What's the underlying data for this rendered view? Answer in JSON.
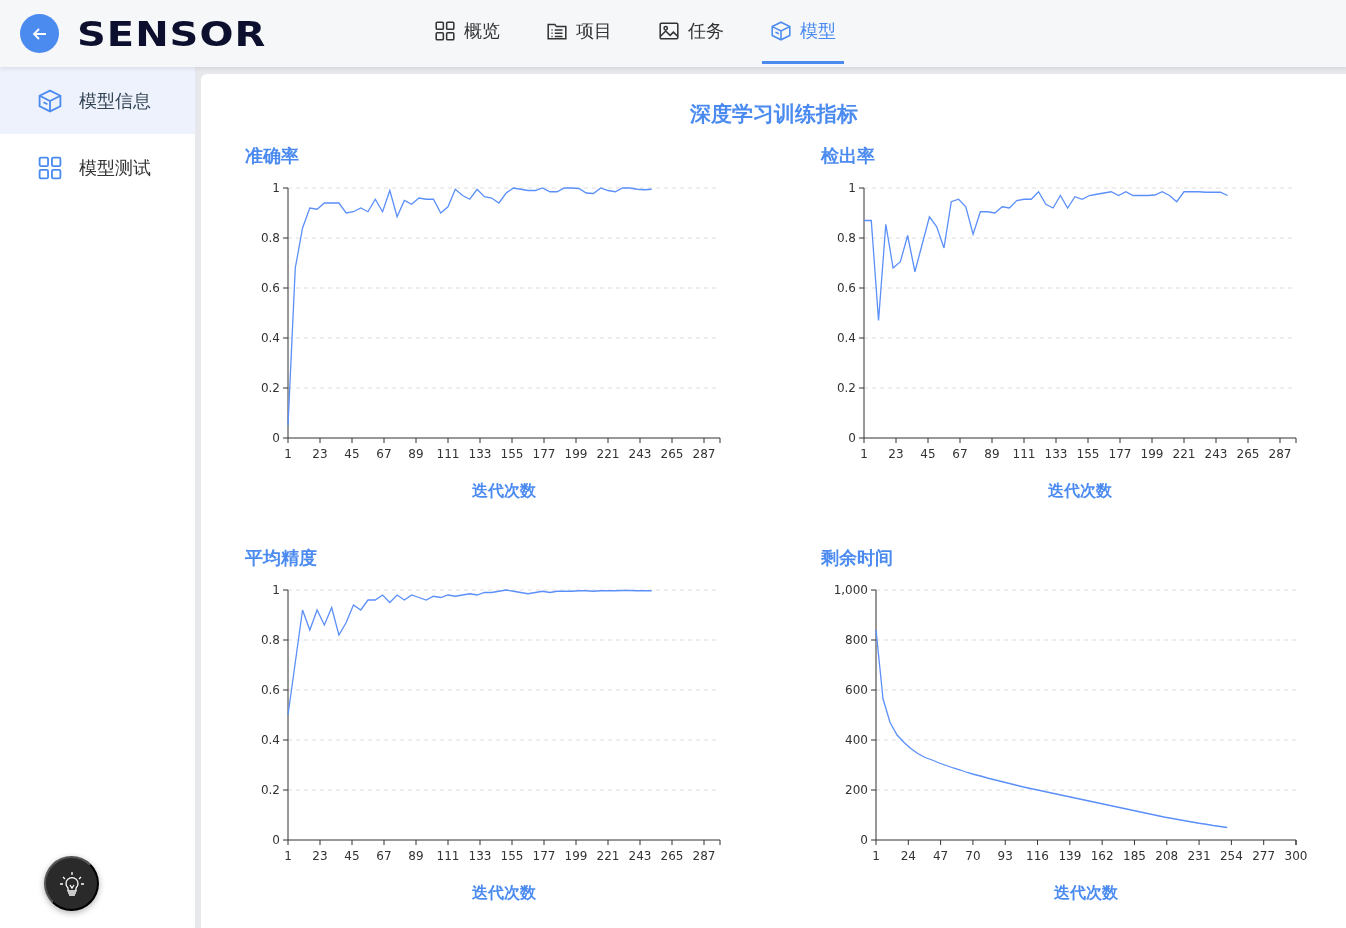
{
  "header": {
    "logo": "SENSOR",
    "nav": [
      {
        "label": "概览",
        "selected": false
      },
      {
        "label": "项目",
        "selected": false
      },
      {
        "label": "任务",
        "selected": false
      },
      {
        "label": "模型",
        "selected": true
      }
    ]
  },
  "sidebar": {
    "items": [
      {
        "label": "模型信息",
        "selected": true
      },
      {
        "label": "模型测试",
        "selected": false
      }
    ]
  },
  "page_title": "深度学习训练指标",
  "charts": [
    {
      "chart_data": {
        "type": "line",
        "grid": true,
        "title": "准确率",
        "xlabel": "迭代次数",
        "xlim": [
          1,
          298
        ],
        "ylim": [
          0,
          1
        ],
        "xticks": [
          1,
          23,
          45,
          67,
          89,
          111,
          133,
          155,
          177,
          199,
          221,
          243,
          265,
          287
        ],
        "yticks": [
          0,
          0.2,
          0.4,
          0.6,
          0.8,
          1
        ],
        "x": [
          1,
          6,
          11,
          16,
          21,
          26,
          31,
          36,
          41,
          46,
          51,
          56,
          61,
          66,
          71,
          76,
          81,
          86,
          91,
          96,
          101,
          106,
          111,
          116,
          121,
          126,
          131,
          136,
          141,
          146,
          151,
          156,
          161,
          166,
          171,
          176,
          181,
          186,
          191,
          196,
          201,
          206,
          211,
          216,
          221,
          226,
          231,
          236,
          241,
          246,
          251
        ],
        "series": [
          {
            "color": "#5b8ff9",
            "values": [
              0.05,
              0.68,
              0.84,
              0.92,
              0.915,
              0.94,
              0.94,
              0.94,
              0.9,
              0.905,
              0.92,
              0.905,
              0.955,
              0.905,
              0.99,
              0.885,
              0.95,
              0.935,
              0.96,
              0.955,
              0.955,
              0.9,
              0.925,
              0.995,
              0.97,
              0.955,
              0.995,
              0.965,
              0.96,
              0.94,
              0.98,
              1,
              0.995,
              0.99,
              0.99,
              1,
              0.985,
              0.985,
              1,
              1,
              0.998,
              0.98,
              0.978,
              1,
              0.99,
              0.985,
              1,
              1,
              0.995,
              0.993,
              0.995
            ]
          }
        ]
      }
    },
    {
      "chart_data": {
        "type": "line",
        "grid": true,
        "title": "检出率",
        "xlabel": "迭代次数",
        "xlim": [
          1,
          298
        ],
        "ylim": [
          0,
          1
        ],
        "xticks": [
          1,
          23,
          45,
          67,
          89,
          111,
          133,
          155,
          177,
          199,
          221,
          243,
          265,
          287
        ],
        "yticks": [
          0,
          0.2,
          0.4,
          0.6,
          0.8,
          1
        ],
        "x": [
          1,
          6,
          11,
          16,
          21,
          26,
          31,
          36,
          41,
          46,
          51,
          56,
          61,
          66,
          71,
          76,
          81,
          86,
          91,
          96,
          101,
          106,
          111,
          116,
          121,
          126,
          131,
          136,
          141,
          146,
          151,
          156,
          161,
          166,
          171,
          176,
          181,
          186,
          191,
          196,
          201,
          206,
          211,
          216,
          221,
          226,
          231,
          236,
          241,
          246,
          251
        ],
        "series": [
          {
            "color": "#5b8ff9",
            "values": [
              0.87,
              0.87,
              0.47,
              0.855,
              0.68,
              0.705,
              0.81,
              0.665,
              0.775,
              0.885,
              0.845,
              0.76,
              0.945,
              0.955,
              0.925,
              0.815,
              0.905,
              0.905,
              0.9,
              0.925,
              0.92,
              0.95,
              0.955,
              0.955,
              0.985,
              0.935,
              0.92,
              0.97,
              0.92,
              0.965,
              0.955,
              0.97,
              0.975,
              0.98,
              0.985,
              0.97,
              0.985,
              0.97,
              0.97,
              0.97,
              0.972,
              0.985,
              0.97,
              0.945,
              0.985,
              0.985,
              0.985,
              0.983,
              0.983,
              0.983,
              0.97
            ]
          }
        ]
      }
    },
    {
      "chart_data": {
        "type": "line",
        "grid": true,
        "title": "平均精度",
        "xlabel": "迭代次数",
        "xlim": [
          1,
          298
        ],
        "ylim": [
          0,
          1
        ],
        "xticks": [
          1,
          23,
          45,
          67,
          89,
          111,
          133,
          155,
          177,
          199,
          221,
          243,
          265,
          287
        ],
        "yticks": [
          0,
          0.2,
          0.4,
          0.6,
          0.8,
          1
        ],
        "x": [
          1,
          6,
          11,
          16,
          21,
          26,
          31,
          36,
          41,
          46,
          51,
          56,
          61,
          66,
          71,
          76,
          81,
          86,
          91,
          96,
          101,
          106,
          111,
          116,
          121,
          126,
          131,
          136,
          141,
          146,
          151,
          156,
          161,
          166,
          171,
          176,
          181,
          186,
          191,
          196,
          201,
          206,
          211,
          216,
          221,
          226,
          231,
          236,
          241,
          246,
          251
        ],
        "series": [
          {
            "color": "#5b8ff9",
            "values": [
              0.5,
              0.71,
              0.92,
              0.84,
              0.92,
              0.86,
              0.93,
              0.82,
              0.87,
              0.94,
              0.92,
              0.96,
              0.96,
              0.98,
              0.95,
              0.98,
              0.96,
              0.98,
              0.97,
              0.96,
              0.975,
              0.97,
              0.98,
              0.975,
              0.98,
              0.985,
              0.98,
              0.99,
              0.99,
              0.995,
              1,
              0.995,
              0.99,
              0.985,
              0.99,
              0.995,
              0.99,
              0.995,
              0.995,
              0.995,
              0.997,
              0.997,
              0.995,
              0.997,
              0.997,
              0.997,
              0.998,
              0.998,
              0.997,
              0.997,
              0.997
            ]
          }
        ]
      }
    },
    {
      "chart_data": {
        "type": "line",
        "grid": true,
        "title": "剩余时间",
        "xlabel": "迭代次数",
        "xlim": [
          1,
          300
        ],
        "ylim": [
          0,
          1000
        ],
        "xticks": [
          1,
          24,
          47,
          70,
          93,
          116,
          139,
          162,
          185,
          208,
          231,
          254,
          277,
          300
        ],
        "yticks": [
          0,
          200,
          400,
          600,
          800,
          {
            "value": 1000,
            "label": "1,000"
          }
        ],
        "x": [
          1,
          6,
          11,
          16,
          21,
          26,
          31,
          36,
          41,
          46,
          51,
          56,
          61,
          66,
          71,
          76,
          81,
          86,
          91,
          96,
          101,
          106,
          111,
          116,
          121,
          126,
          131,
          136,
          141,
          146,
          151,
          156,
          161,
          166,
          171,
          176,
          181,
          186,
          191,
          196,
          201,
          206,
          211,
          216,
          221,
          226,
          231,
          236,
          241,
          246,
          251
        ],
        "series": [
          {
            "color": "#5b8ff9",
            "values": [
              840,
              565,
              470,
              420,
              390,
              365,
              345,
              330,
              320,
              308,
              298,
              288,
              280,
              270,
              262,
              255,
              247,
              240,
              233,
              226,
              219,
              212,
              206,
              200,
              194,
              188,
              182,
              176,
              170,
              164,
              158,
              152,
              146,
              140,
              134,
              128,
              122,
              116,
              110,
              104,
              98,
              92,
              87,
              82,
              77,
              72,
              67,
              63,
              58,
              54,
              50
            ]
          }
        ]
      }
    }
  ]
}
